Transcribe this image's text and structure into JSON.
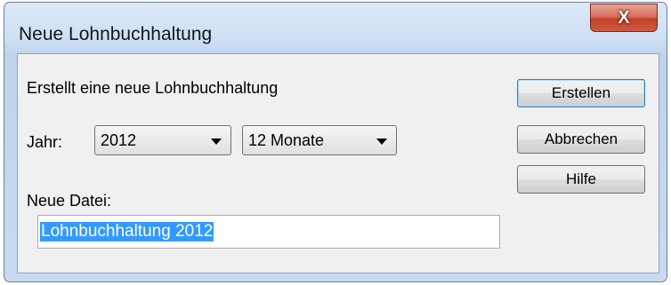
{
  "window": {
    "title": "Neue Lohnbuchhaltung",
    "close_label": "X"
  },
  "form": {
    "caption": "Erstellt eine neue Lohnbuchhaltung",
    "year_label": "Jahr:",
    "year_value": "2012",
    "months_value": "12 Monate",
    "file_label": "Neue Datei:",
    "file_value": "Lohnbuchhaltung 2012"
  },
  "buttons": {
    "create": "Erstellen",
    "cancel": "Abbrechen",
    "help": "Hilfe"
  }
}
